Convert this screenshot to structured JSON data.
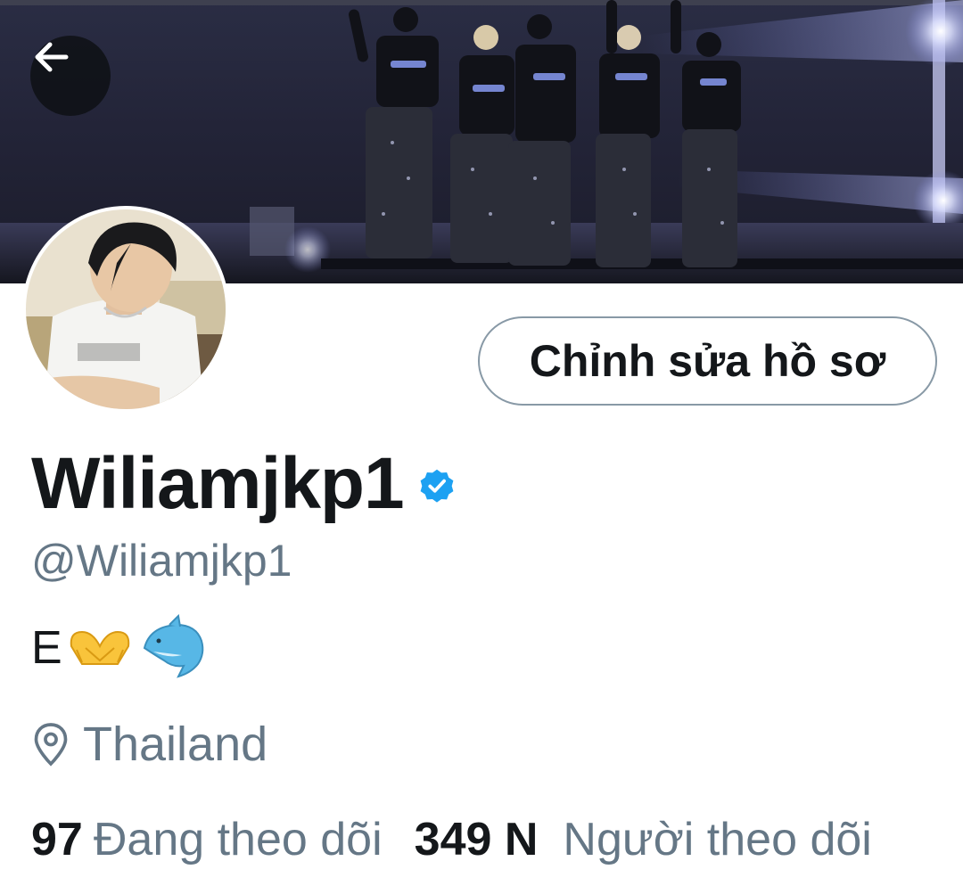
{
  "header": {
    "back_icon": "arrow-left-icon"
  },
  "profile": {
    "edit_button_label": "Chỉnh sửa hồ sơ",
    "display_name": "Wiliamjkp1",
    "verified_icon": "verified-badge-icon",
    "handle": "@Wiliamjkp1",
    "bio_text": "E",
    "bio_emojis": [
      "heart-hands-emoji",
      "dolphin-emoji"
    ],
    "location_icon": "location-pin-icon",
    "location": "Thailand",
    "following_count": "97",
    "following_label": "Đang theo dõi",
    "followers_count": "349 N",
    "followers_label": "Người theo dõi"
  },
  "colors": {
    "primary_text": "#14171a",
    "secondary_text": "#657786",
    "verified_blue": "#1da1f2",
    "button_border": "#8899a6",
    "back_button_bg": "#0f1116"
  }
}
